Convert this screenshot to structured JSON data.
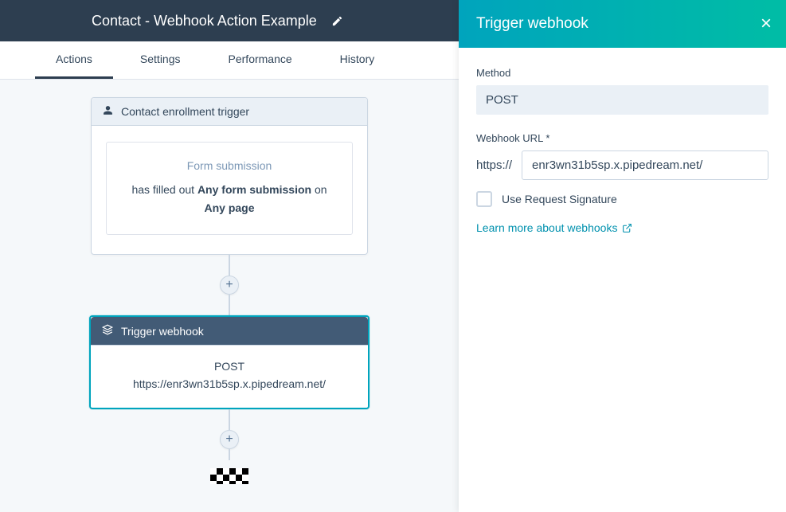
{
  "header": {
    "title": "Contact - Webhook Action Example"
  },
  "tabs": {
    "actions": "Actions",
    "settings": "Settings",
    "performance": "Performance",
    "history": "History"
  },
  "trigger_card": {
    "header": "Contact enrollment trigger",
    "inner_heading": "Form submission",
    "line_prefix": "has filled out ",
    "line_bold1": "Any form submission",
    "line_mid": " on",
    "line_bold2": "Any page"
  },
  "webhook_card": {
    "header": "Trigger webhook",
    "method": "POST",
    "url": "https://enr3wn31b5sp.x.pipedream.net/"
  },
  "panel": {
    "title": "Trigger webhook",
    "method_label": "Method",
    "method_value": "POST",
    "url_label": "Webhook URL *",
    "url_prefix": "https://",
    "url_value": "enr3wn31b5sp.x.pipedream.net/",
    "checkbox_label": "Use Request Signature",
    "learn_link": "Learn more about webhooks"
  }
}
